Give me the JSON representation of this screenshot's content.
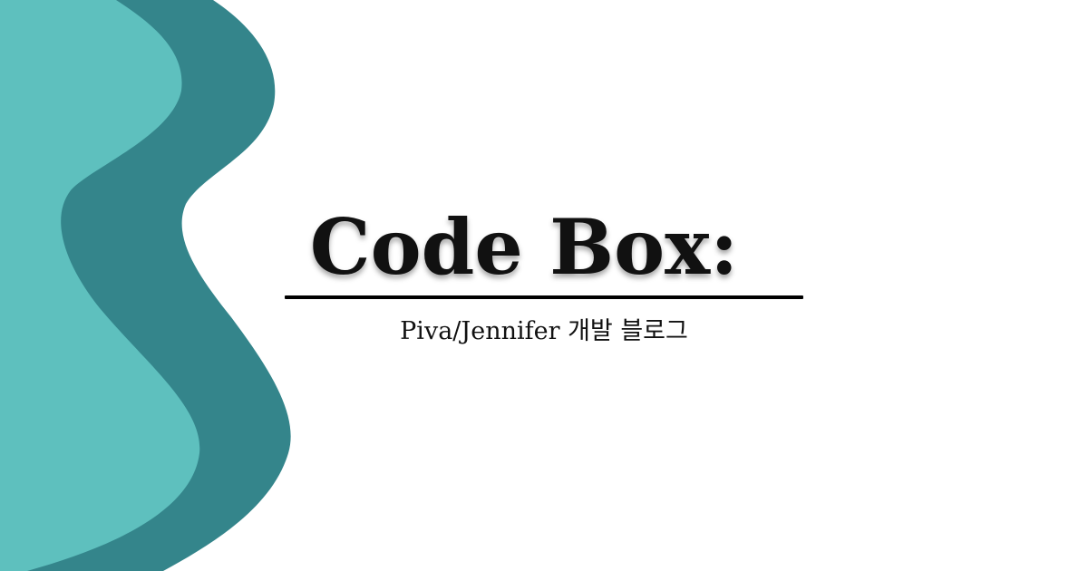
{
  "header": {
    "title": "Code Box:",
    "subtitle": "Piva/Jennifer 개발 블로그"
  },
  "decoration": {
    "wave_icon": "wave-shape-icon",
    "colors": {
      "background": "#ffffff",
      "wave_dark": "#34858b",
      "wave_light": "#5ec0be",
      "text": "#111111",
      "rule": "#000000"
    }
  }
}
